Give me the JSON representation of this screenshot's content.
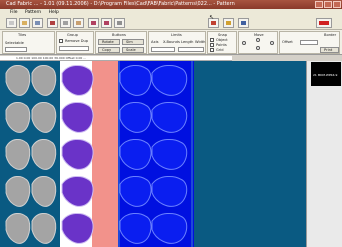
{
  "window": {
    "title": "Cad Fabric ... - 1.01 (09.11.2006) - D:\\Program Files\\Cad\\FAB\\Fabric\\Patterns\\022... - Pattern"
  },
  "menu": {
    "items": [
      "File",
      "Pattern",
      "Help"
    ]
  },
  "panel": {
    "section_labels": [
      "Tiles",
      "Group",
      "Buttons",
      "Limits",
      "Snap",
      "Move",
      "Border"
    ],
    "field_labels": [
      "Selectable",
      "Remove Dup",
      "Rotate",
      "Sim",
      "Axis",
      "X-Bounds",
      "Length",
      "Width",
      "Ratio",
      "Copy",
      "Scale",
      "Rotate",
      "Object",
      "Points",
      "Grid",
      "Offset",
      "Print"
    ],
    "info_text": "1.00    0.00    100.00    100.00    36.000    Offset    0.00    ..."
  },
  "thumbnail": {
    "caption": "21 MKM.WPK4.9"
  }
}
